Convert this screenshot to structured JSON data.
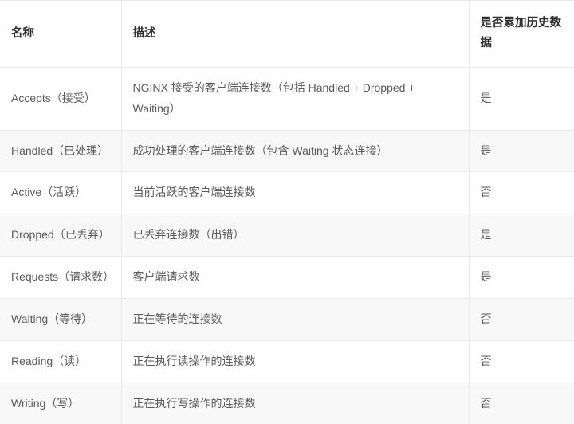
{
  "table": {
    "columns": [
      {
        "key": "name",
        "label": "名称"
      },
      {
        "key": "description",
        "label": "描述"
      },
      {
        "key": "cumulative",
        "label": "是否累加历史数据"
      }
    ],
    "rows": [
      {
        "name": "Accepts（接受）",
        "description": "NGINX 接受的客户端连接数（包括 Handled + Dropped + Waiting）",
        "cumulative": "是",
        "stripe": false
      },
      {
        "name": "Handled（已处理）",
        "description": "成功处理的客户端连接数（包含 Waiting 状态连接）",
        "cumulative": "是",
        "stripe": true
      },
      {
        "name": "Active（活跃）",
        "description": "当前活跃的客户端连接数",
        "cumulative": "否",
        "stripe": false
      },
      {
        "name": "Dropped（已丢弃）",
        "description": "已丢弃连接数（出错）",
        "cumulative": "是",
        "stripe": true
      },
      {
        "name": "Requests（请求数）",
        "description": "客户端请求数",
        "cumulative": "是",
        "stripe": false
      },
      {
        "name": "Waiting（等待）",
        "description": "正在等待的连接数",
        "cumulative": "否",
        "stripe": true
      },
      {
        "name": "Reading（读）",
        "description": "正在执行读操作的连接数",
        "cumulative": "否",
        "stripe": false
      },
      {
        "name": "Writing（写）",
        "description": "正在执行写操作的连接数",
        "cumulative": "否",
        "stripe": true
      }
    ]
  },
  "colors": {
    "stripe_background": "#f8f8f8",
    "row_background": "#ffffff",
    "border": "#e9e9e9",
    "header_text": "#2f2f2f",
    "body_text": "#5a5a5a"
  }
}
